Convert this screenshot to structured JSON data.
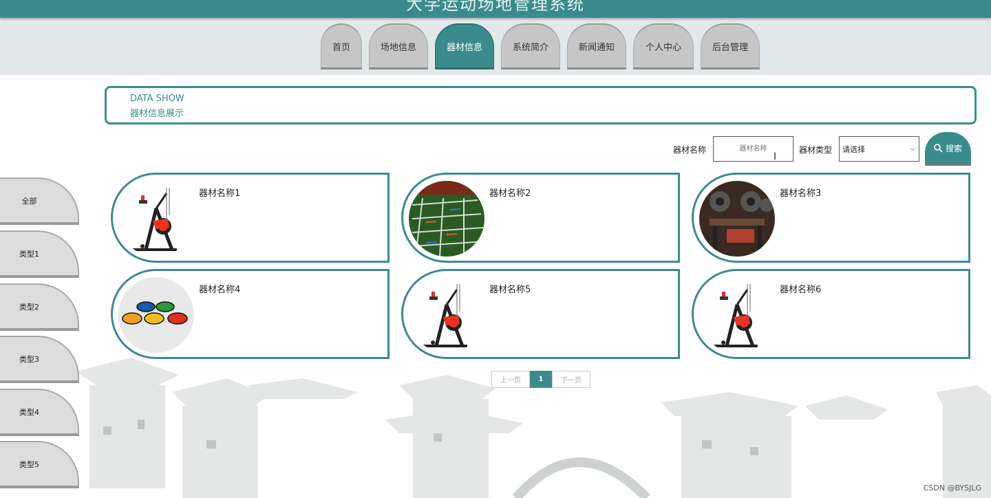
{
  "header": {
    "title": "大学运动场地管理系统"
  },
  "nav": {
    "items": [
      {
        "label": "首页"
      },
      {
        "label": "场地信息"
      },
      {
        "label": "器材信息"
      },
      {
        "label": "系统简介"
      },
      {
        "label": "新闻通知"
      },
      {
        "label": "个人中心"
      },
      {
        "label": "后台管理"
      }
    ],
    "active_index": 2
  },
  "datashow": {
    "en": "DATA SHOW",
    "cn": "器材信息展示"
  },
  "search": {
    "name_label": "器材名称",
    "name_placeholder": "器材名称",
    "type_label": "器材类型",
    "type_selected": "请选择",
    "button_label": "搜索"
  },
  "sidebar": {
    "items": [
      {
        "label": "全部"
      },
      {
        "label": "类型1"
      },
      {
        "label": "类型2"
      },
      {
        "label": "类型3"
      },
      {
        "label": "类型4"
      },
      {
        "label": "类型5"
      }
    ]
  },
  "cards": [
    {
      "name": "器材名称1",
      "image": "exercise-bike"
    },
    {
      "name": "器材名称2",
      "image": "field-ladder"
    },
    {
      "name": "器材名称3",
      "image": "gym-equipment"
    },
    {
      "name": "器材名称4",
      "image": "marker-discs"
    },
    {
      "name": "器材名称5",
      "image": "exercise-bike"
    },
    {
      "name": "器材名称6",
      "image": "exercise-bike"
    }
  ],
  "pagination": {
    "prev": "上一页",
    "current": "1",
    "next": "下一页"
  },
  "watermark": "CSDN @BYSJLG",
  "colors": {
    "accent": "#3a8c8c",
    "tab_gray": "#c6c6c6",
    "nav_band": "#e2e7ea"
  }
}
